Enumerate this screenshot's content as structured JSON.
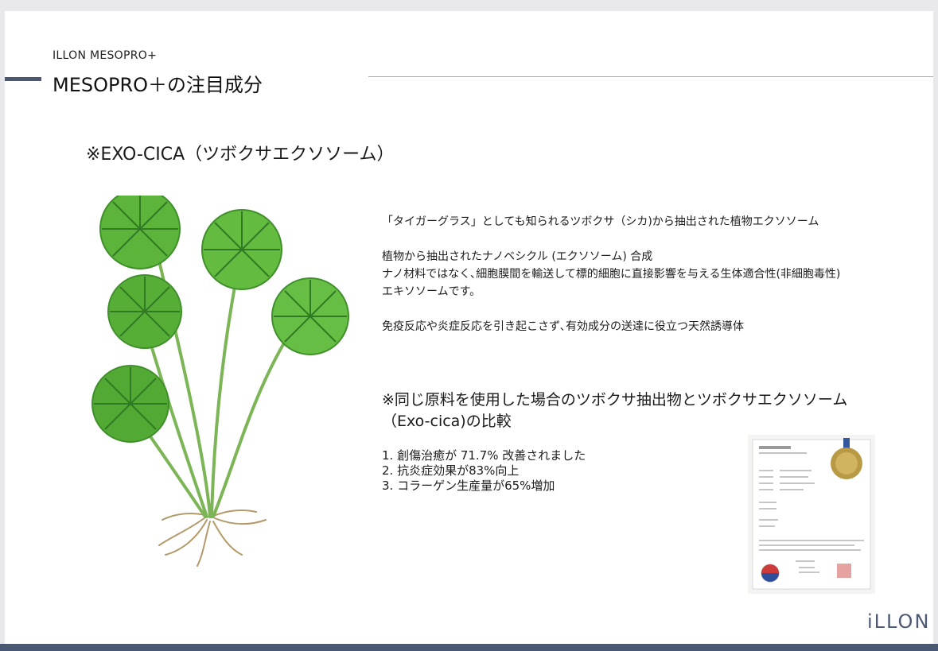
{
  "header": {
    "brand": "ILLON MESOPRO+",
    "title": "MESOPRO＋の注目成分"
  },
  "section": {
    "heading": "※EXO-CICA（ツボクサエクソソーム）"
  },
  "description": {
    "para1": "「タイガーグラス」としても知られるツボクサ（シカ)から抽出された植物エクソソーム",
    "para2_line1": "植物から抽出されたナノベシクル (エクソソーム) 合成",
    "para2_line2": "ナノ材料ではなく､細胞膜間を輸送して標的細胞に直接影響を与える生体適合性(非細胞毒性) エキソソームです。",
    "para3": "免疫反応や炎症反応を引き起こさず､有効成分の送達に役立つ天然誘導体"
  },
  "comparison": {
    "heading": "※同じ原料を使用した場合のツボクサ抽出物とツボクサエクソソーム（Exo-cica)の比較",
    "results": [
      "1. 創傷治癒が 71.7% 改善されました",
      "2. 抗炎症効果が83%向上",
      "3. コラーゲン生産量が65%増加"
    ]
  },
  "footer": {
    "logo": "iLLON"
  },
  "colors": {
    "accent": "#4b5874",
    "leaf": "#5cb43a",
    "leaf_vein": "#2f7a22",
    "root": "#b39a6a"
  },
  "icons": {
    "plant": "centella-asiatica-illustration",
    "certificate": "patent-certificate-image"
  }
}
